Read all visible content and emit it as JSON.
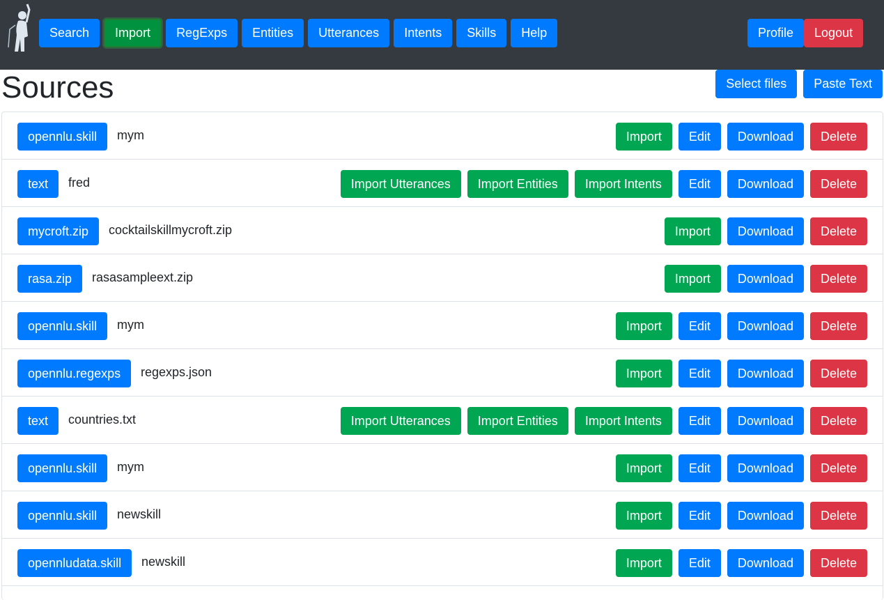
{
  "nav": {
    "items": [
      "Search",
      "Import",
      "RegExps",
      "Entities",
      "Utterances",
      "Intents",
      "Skills",
      "Help"
    ],
    "active": "Import",
    "right": [
      "Profile",
      "Logout"
    ]
  },
  "page": {
    "title": "Sources",
    "select_files": "Select files",
    "paste_text": "Paste Text"
  },
  "labels": {
    "import": "Import",
    "import_utterances": "Import Utterances",
    "import_entities": "Import Entities",
    "import_intents": "Import Intents",
    "edit": "Edit",
    "download": "Download",
    "delete": "Delete"
  },
  "sources": [
    {
      "type": "opennlu.skill",
      "name": "mym",
      "kind": "skill"
    },
    {
      "type": "text",
      "name": "fred",
      "kind": "text"
    },
    {
      "type": "mycroft.zip",
      "name": "cocktailskillmycroft.zip",
      "kind": "zip"
    },
    {
      "type": "rasa.zip",
      "name": "rasasampleext.zip",
      "kind": "zip"
    },
    {
      "type": "opennlu.skill",
      "name": "mym",
      "kind": "skill"
    },
    {
      "type": "opennlu.regexps",
      "name": "regexps.json",
      "kind": "skill"
    },
    {
      "type": "text",
      "name": "countries.txt",
      "kind": "text"
    },
    {
      "type": "opennlu.skill",
      "name": "mym",
      "kind": "skill"
    },
    {
      "type": "opennlu.skill",
      "name": "newskill",
      "kind": "skill"
    },
    {
      "type": "opennludata.skill",
      "name": "newskill",
      "kind": "skill"
    }
  ],
  "colors": {
    "navbar": "#343a40",
    "primary": "#007bff",
    "success": "#00a651",
    "danger": "#dc3545"
  }
}
